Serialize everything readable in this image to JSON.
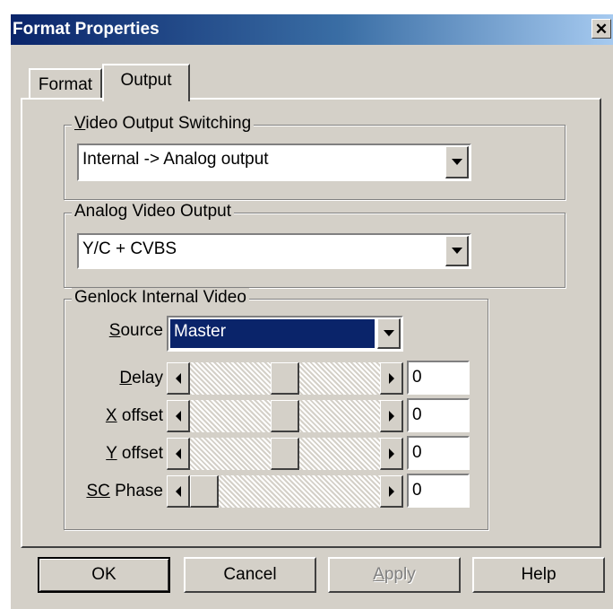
{
  "window": {
    "title": "Format Properties",
    "close_glyph": "✕"
  },
  "tabs": [
    {
      "label": "Format",
      "active": false
    },
    {
      "label": "Output",
      "active": true
    }
  ],
  "video_output_switching": {
    "group_label_prefix": "V",
    "group_label_rest": "ideo Output Switching",
    "value": "Internal -> Analog output"
  },
  "analog_video_output": {
    "group_label": "Analog Video Output",
    "value": "Y/C + CVBS"
  },
  "genlock": {
    "group_label": "Genlock Internal Video",
    "source": {
      "label_prefix": "S",
      "label_rest": "ource",
      "value": "Master"
    },
    "rows": [
      {
        "label_prefix": "D",
        "label_rest": "elay",
        "value": "0",
        "thumb_fraction": 0.5
      },
      {
        "label_prefix": "X",
        "label_rest": " offset",
        "value": "0",
        "thumb_fraction": 0.5
      },
      {
        "label_prefix": "Y",
        "label_rest": " offset",
        "value": "0",
        "thumb_fraction": 0.5
      },
      {
        "label_prefix": "SC",
        "label_rest": " Phase",
        "value": "0",
        "thumb_fraction": 0.0
      }
    ]
  },
  "buttons": {
    "ok": "OK",
    "cancel": "Cancel",
    "apply_prefix": "A",
    "apply_rest": "pply",
    "help": "Help"
  },
  "icons": [
    "close-icon",
    "chevron-down-icon",
    "arrow-left-icon",
    "arrow-right-icon"
  ]
}
